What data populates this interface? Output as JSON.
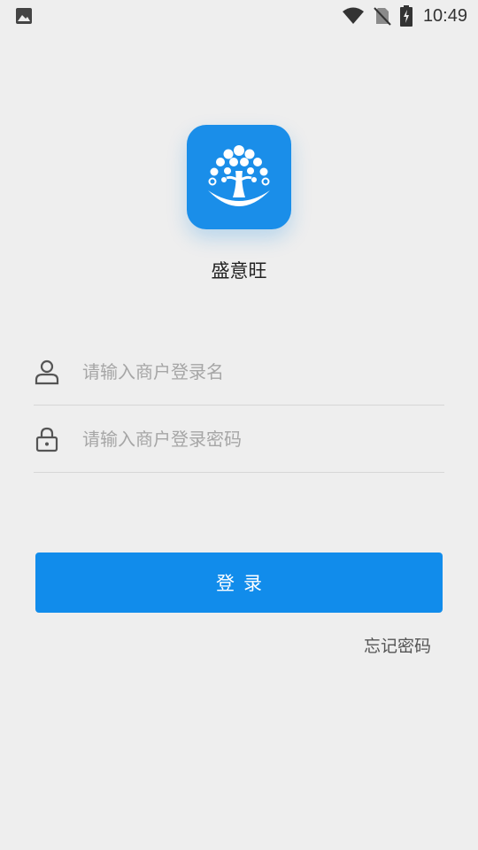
{
  "status_bar": {
    "time": "10:49",
    "icons": [
      "image-icon",
      "wifi-icon",
      "no-sim-icon",
      "battery-charging-icon"
    ]
  },
  "app": {
    "name": "盛意旺",
    "brand_color": "#1a8ee9"
  },
  "form": {
    "username": {
      "placeholder": "请输入商户登录名",
      "value": "",
      "icon": "user-icon"
    },
    "password": {
      "placeholder": "请输入商户登录密码",
      "value": "",
      "icon": "lock-icon"
    },
    "login_label": "登录",
    "forgot_label": "忘记密码"
  }
}
